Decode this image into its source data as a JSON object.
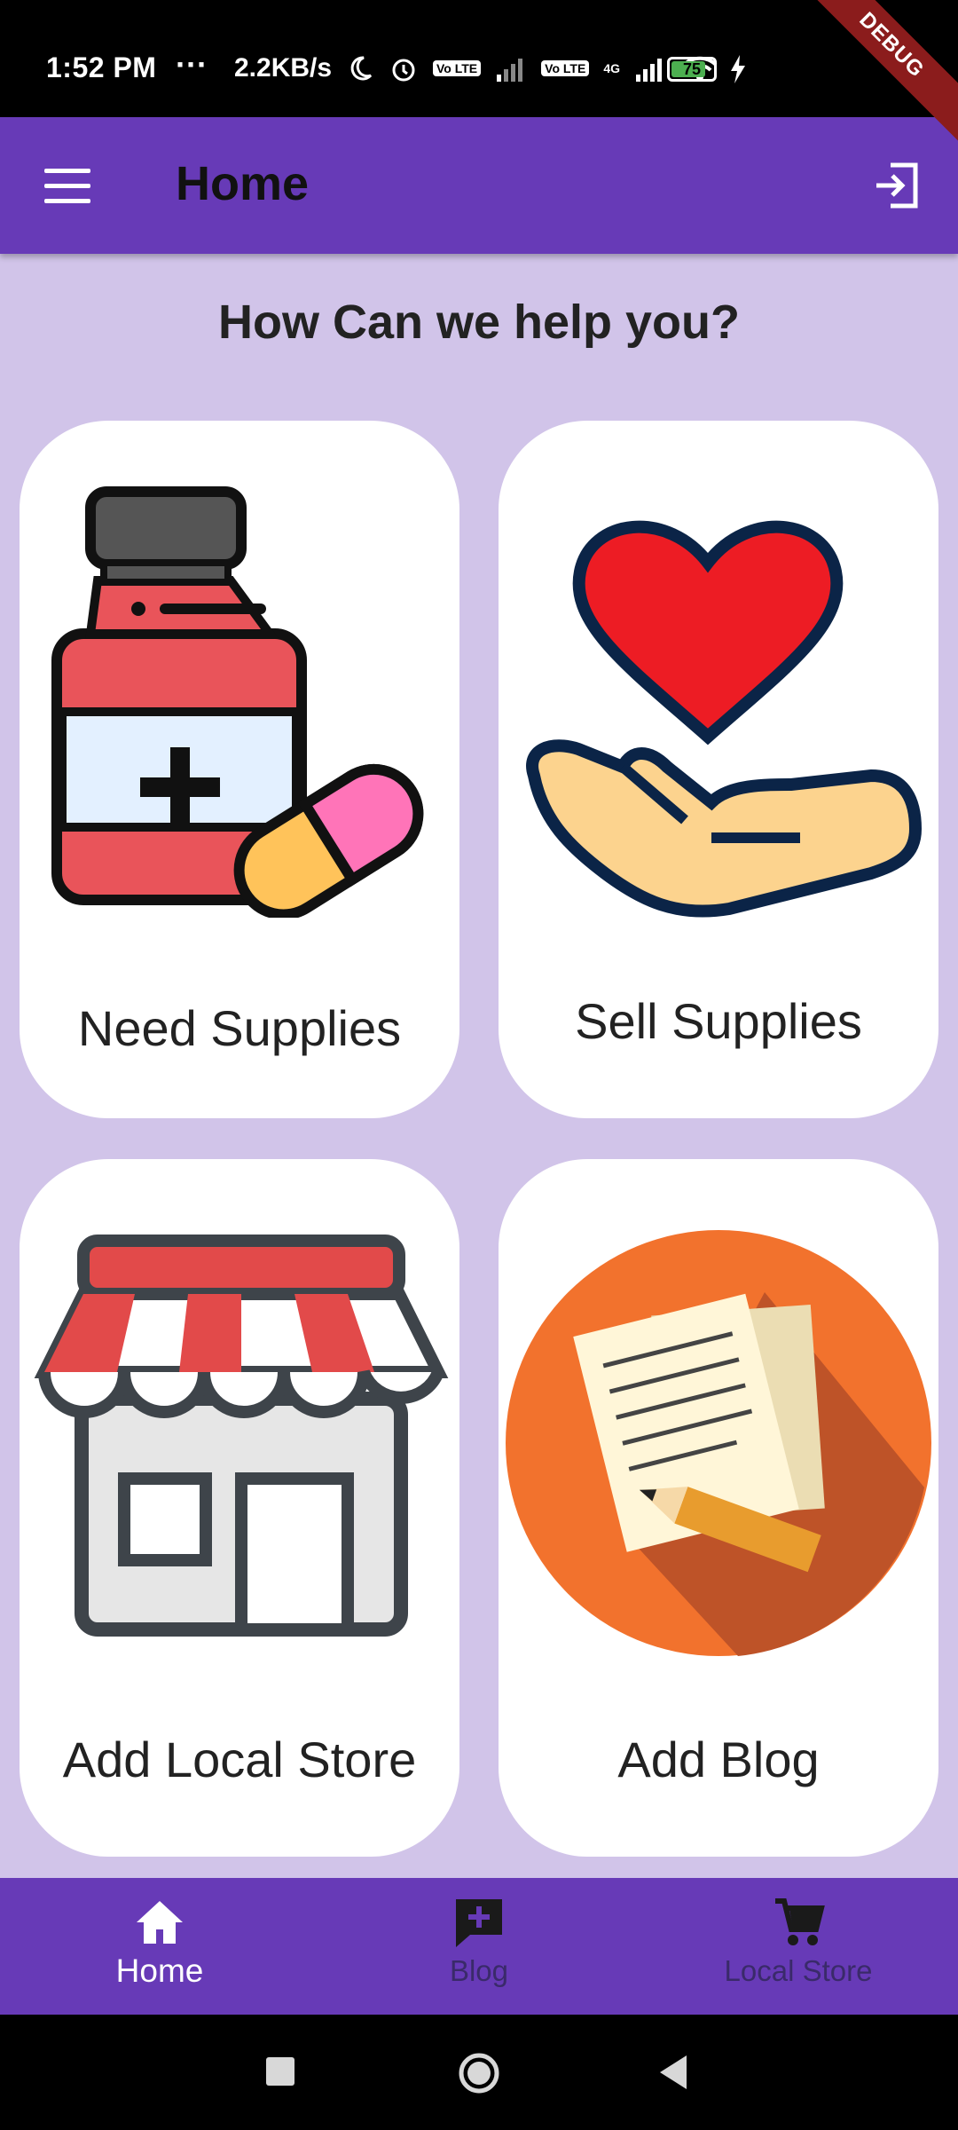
{
  "status_bar": {
    "time": "1:52 PM",
    "dots": "···",
    "speed": "2.2KB/s",
    "volte1": "Vo LTE",
    "volte2": "Vo LTE",
    "network": "4G",
    "battery": "75",
    "debug_banner": "DEBUG"
  },
  "app_bar": {
    "title": "Home",
    "menu_icon": "menu-icon",
    "logout_icon": "logout-icon"
  },
  "heading": "How Can we help you?",
  "cards": [
    {
      "label": "Need Supplies",
      "icon": "medicine-bottle-pills"
    },
    {
      "label": "Sell Supplies",
      "icon": "heart-in-hand"
    },
    {
      "label": "Add Local Store",
      "icon": "storefront"
    },
    {
      "label": "Add Blog",
      "icon": "paper-and-pencil"
    }
  ],
  "bottom_nav": {
    "items": [
      {
        "label": "Home",
        "icon": "home-icon",
        "active": true
      },
      {
        "label": "Blog",
        "icon": "add-comment-icon",
        "active": false
      },
      {
        "label": "Local Store",
        "icon": "cart-icon",
        "active": false
      }
    ]
  },
  "colors": {
    "primary": "#673AB7",
    "background": "#D1C4E9",
    "card": "#FFFFFF"
  }
}
